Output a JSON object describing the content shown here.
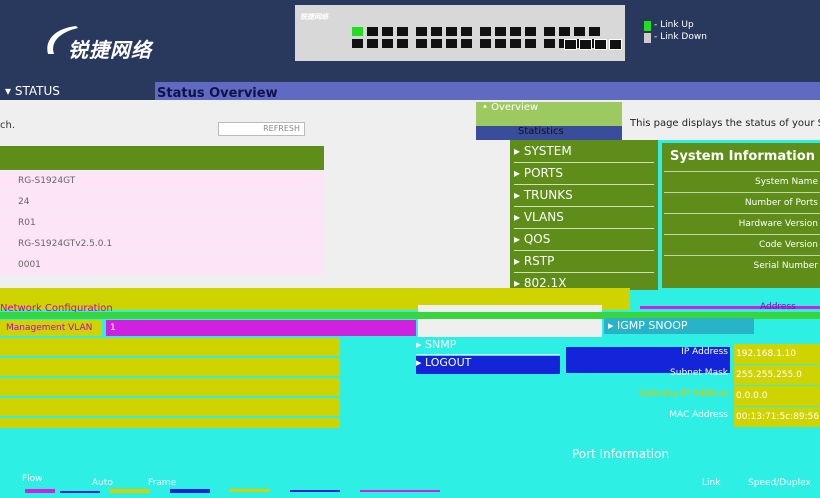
{
  "header": {
    "brand": "锐捷网络",
    "switch_brand": "锐捷网络",
    "legend": {
      "link_up": "- Link Up",
      "link_down": "- Link Down"
    },
    "colors": {
      "link_up": "#22dd22",
      "link_down": "#cccccc",
      "header_bg": "#29395e"
    }
  },
  "status_bar": {
    "label": "▾ STATUS",
    "title": "Status Overview"
  },
  "main": {
    "refresh_label": "ch.",
    "refresh_button": "REFRESH",
    "description": "This page displays the status of your Swi",
    "device_values": [
      "RG-S1924GT",
      "24",
      "R01",
      "RG-S1924GTv2.5.0.1",
      "0001"
    ]
  },
  "nav": {
    "overview": "• Overview",
    "statistics": "Statistics",
    "items": [
      "▸ SYSTEM",
      "▸ PORTS",
      "▸ TRUNKS",
      "▸ VLANS",
      "▸ QOS",
      "▸ RSTP",
      "▸ 802.1X"
    ],
    "igmp": "▸ IGMP SNOOP",
    "snmp": "▸ SNMP",
    "logout": "▸ LOGOUT"
  },
  "system_info": {
    "title": "System Information",
    "labels": [
      "System Name",
      "Number of Ports",
      "Hardware Version",
      "Code Version",
      "Serial Number"
    ]
  },
  "network": {
    "config_label": "Network Configuration",
    "address_label": "Address",
    "mgmt_vlan_label": "Management VLAN",
    "mgmt_vlan_value": "1",
    "ip_labels": [
      "IP Address",
      "Subnet Mask",
      "Gateway IP Address",
      "MAC Address"
    ],
    "ip_values": [
      "192.168.1.10",
      "255.255.255.0",
      "0.0.0.0",
      "00:13:71:5c:89:56"
    ]
  },
  "port_info": {
    "title": "Port Information",
    "columns": [
      "Flow",
      "Auto",
      "Frame",
      "Link",
      "Speed/Duplex"
    ]
  }
}
